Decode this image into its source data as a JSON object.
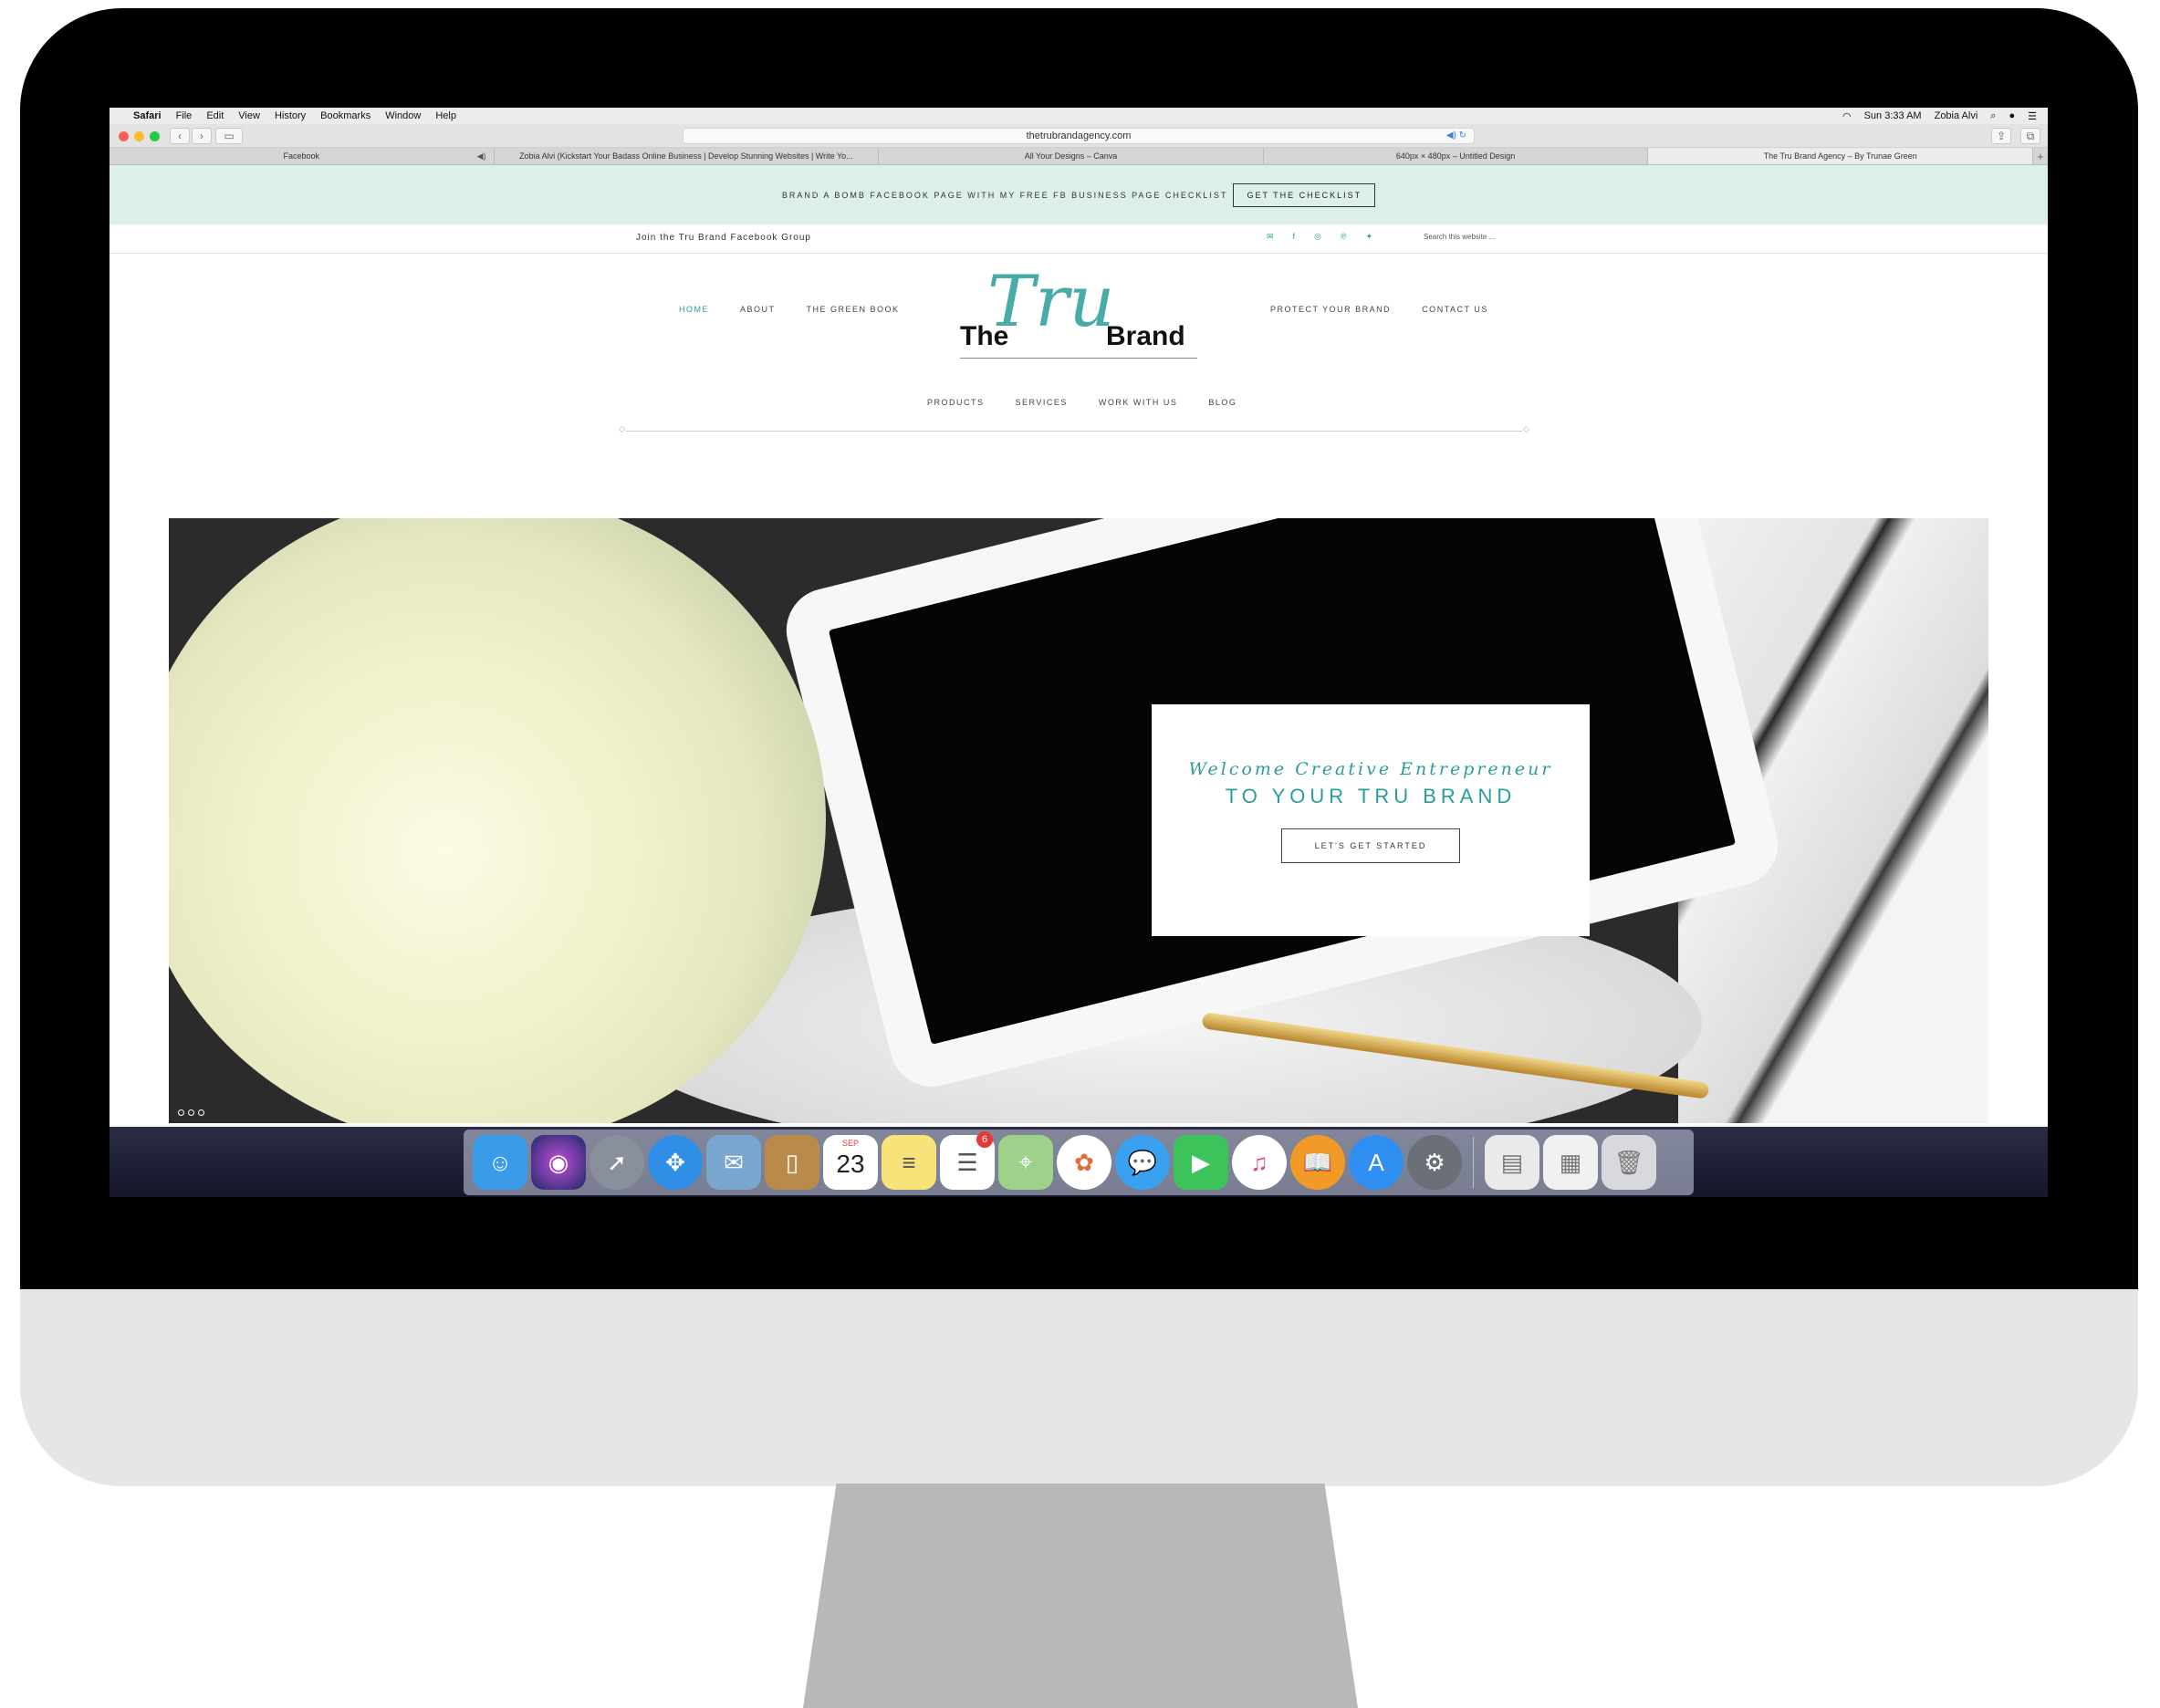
{
  "menubar": {
    "app": "Safari",
    "items": [
      "File",
      "Edit",
      "View",
      "History",
      "Bookmarks",
      "Window",
      "Help"
    ],
    "clock": "Sun 3:33 AM",
    "user": "Zobia Alvi"
  },
  "toolbar": {
    "url": "thetrubrandagency.com"
  },
  "tabs": [
    {
      "label": "Facebook"
    },
    {
      "label": "Zobia Alvi (Kickstart Your Badass Online Business | Develop Stunning Websites | Write Yo..."
    },
    {
      "label": "All Your Designs – Canva"
    },
    {
      "label": "640px × 480px – Untitled Design"
    },
    {
      "label": "The Tru Brand Agency – By Trunae Green"
    }
  ],
  "promo": {
    "text": "BRAND A BOMB FACEBOOK PAGE WITH MY FREE FB BUSINESS PAGE CHECKLIST",
    "button": "GET THE CHECKLIST"
  },
  "topbar": {
    "group": "Join the Tru Brand Facebook Group",
    "search_placeholder": "Search this website ..."
  },
  "logo": {
    "the": "The",
    "tru": "Tru",
    "brand": "Brand"
  },
  "nav": {
    "left": [
      "HOME",
      "ABOUT",
      "THE GREEN BOOK"
    ],
    "right": [
      "PROTECT YOUR BRAND",
      "CONTACT US"
    ],
    "bottom": [
      "PRODUCTS",
      "SERVICES",
      "WORK WITH US",
      "BLOG"
    ]
  },
  "hero": {
    "line1": "Welcome Creative Entrepreneur",
    "line2": "TO YOUR TRU BRAND",
    "button": "LET'S GET STARTED"
  },
  "dock": {
    "calendar_month": "SEP",
    "calendar_day": "23",
    "reminders_badge": "6"
  },
  "colors": {
    "accent": "#2a9d9a",
    "promo_bg": "#dcefe9"
  }
}
